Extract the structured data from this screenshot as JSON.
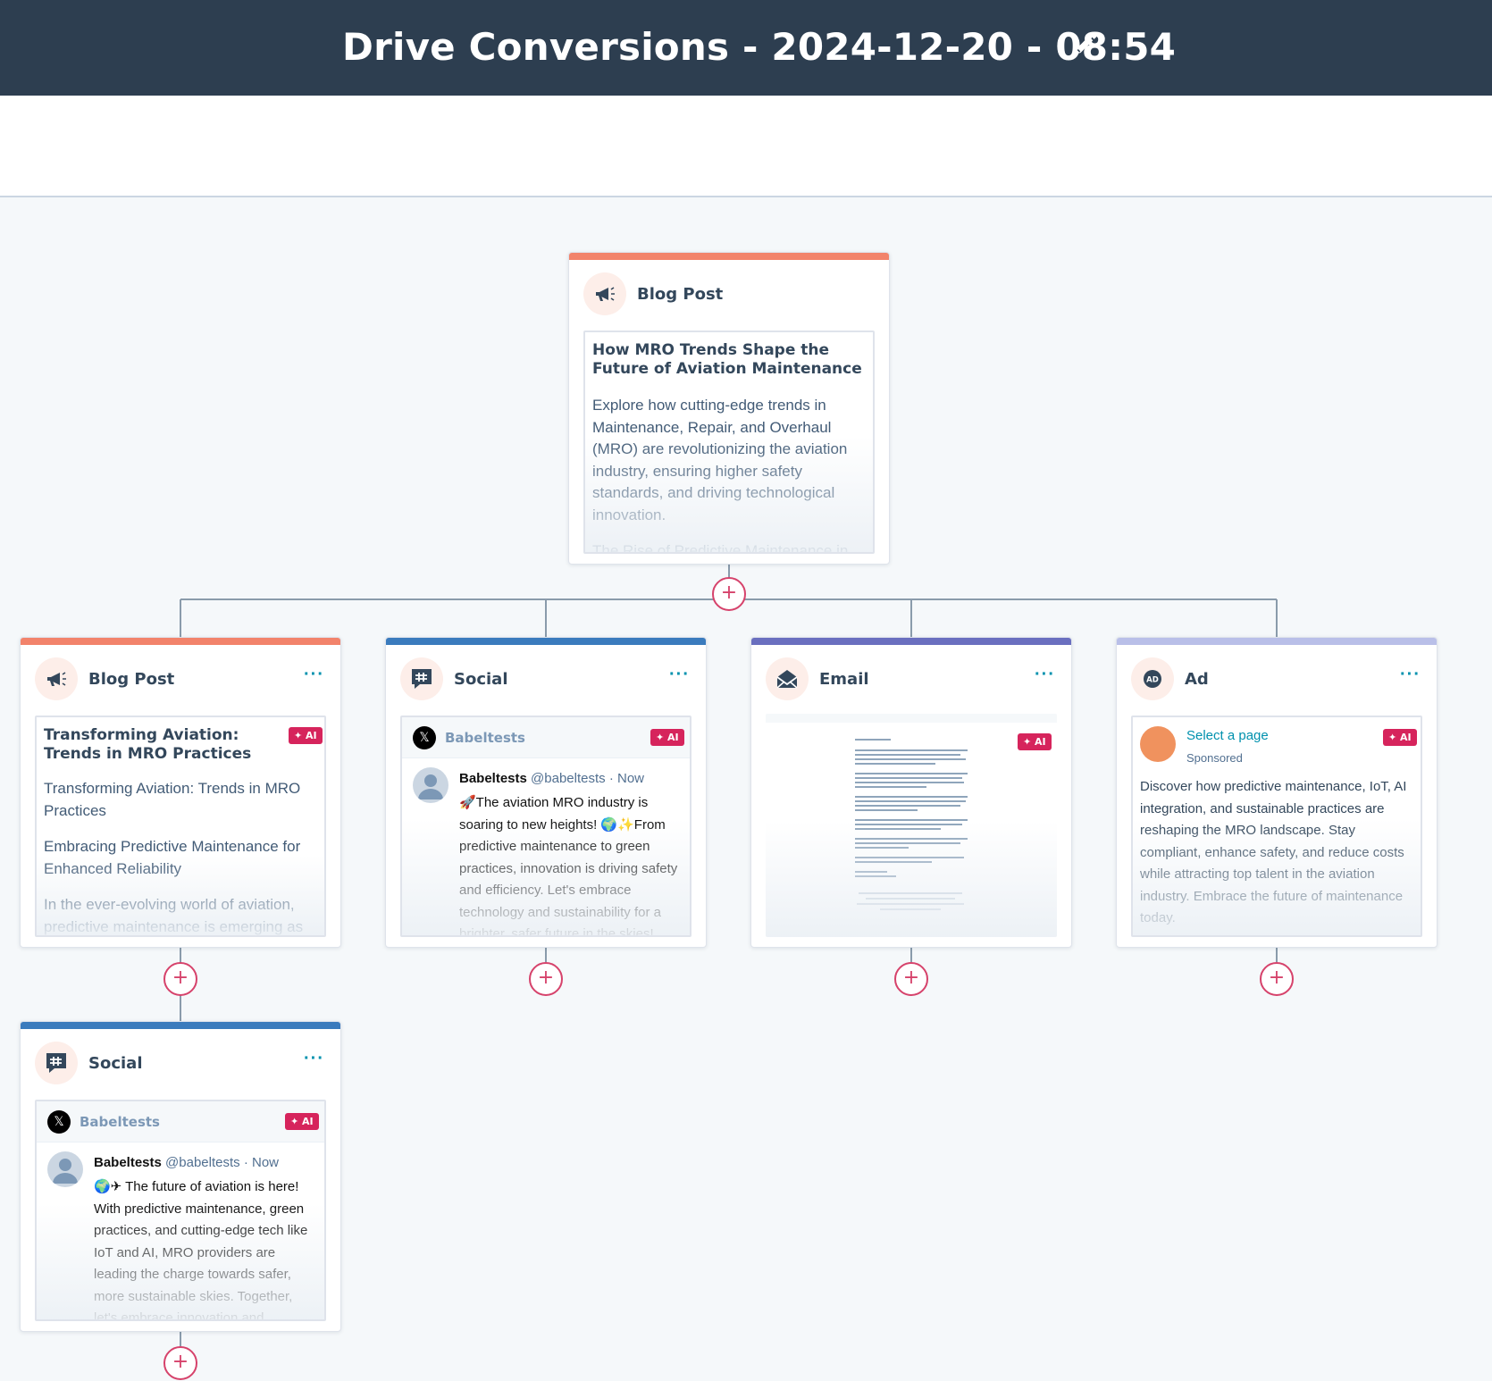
{
  "header": {
    "title": "Drive Conversions - 2024-12-20 - 08:54"
  },
  "root": {
    "type": "Blog Post",
    "heading": "How MRO Trends Shape the Future of Aviation Maintenance",
    "body": "Explore how cutting-edge trends in Maintenance, Repair, and Overhaul (MRO) are revolutionizing the aviation industry, ensuring higher safety standards, and driving technological innovation.",
    "cutoff": "The Rise of Predictive Maintenance in"
  },
  "cards": {
    "blog": {
      "type": "Blog Post",
      "ai": "✦ AI",
      "heading": "Transforming Aviation: Trends in MRO Practices",
      "subtitle": "Transforming Aviation: Trends in MRO Practices",
      "section": "Embracing Predictive Maintenance for Enhanced Reliability",
      "intro": "In the ever-evolving world of aviation, predictive maintenance is emerging as"
    },
    "social1": {
      "type": "Social",
      "ai": "✦ AI",
      "account": "Babeltests",
      "name": "Babeltests",
      "handle": "@babeltests",
      "time": "Now",
      "body": "🚀The aviation MRO industry is soaring to new heights! 🌍✨From predictive maintenance to green practices, innovation is driving safety and efficiency. Let's embrace technology and sustainability for a brighter, safer future in the skies!"
    },
    "email": {
      "type": "Email",
      "ai": "✦ AI"
    },
    "ad": {
      "type": "Ad",
      "ai": "✦ AI",
      "select": "Select a page",
      "sponsored": "Sponsored",
      "body": "Discover how predictive maintenance, IoT, AI integration, and sustainable practices are reshaping the MRO landscape. Stay compliant, enhance safety, and reduce costs while attracting top talent in the aviation industry. Embrace the future of maintenance today."
    },
    "social2": {
      "type": "Social",
      "ai": "✦ AI",
      "account": "Babeltests",
      "name": "Babeltests",
      "handle": "@babeltests",
      "time": "Now",
      "body": "🌍✈ The future of aviation is here! With predictive maintenance, green practices, and cutting-edge tech like IoT and AI, MRO providers are leading the charge towards safer, more sustainable skies. Together, let's embrace innovation and sustainability"
    }
  },
  "menu_glyph": "···",
  "add_glyph": "+",
  "colors": {
    "header_bg": "#2d3e50",
    "blog_bar": "#f2836b",
    "social_bar": "#3a7bbd",
    "email_bar": "#6a6fbf",
    "ad_bar": "#b9bfe8",
    "ai_badge": "#d6245c",
    "add_button": "#d6426b",
    "link": "#0091ae"
  },
  "icons": [
    "megaphone-icon",
    "hashtag-chat-icon",
    "envelope-open-icon",
    "ad-icon",
    "pencil-icon",
    "x-logo-icon",
    "user-avatar-icon",
    "plus-icon",
    "more-dots-icon"
  ]
}
